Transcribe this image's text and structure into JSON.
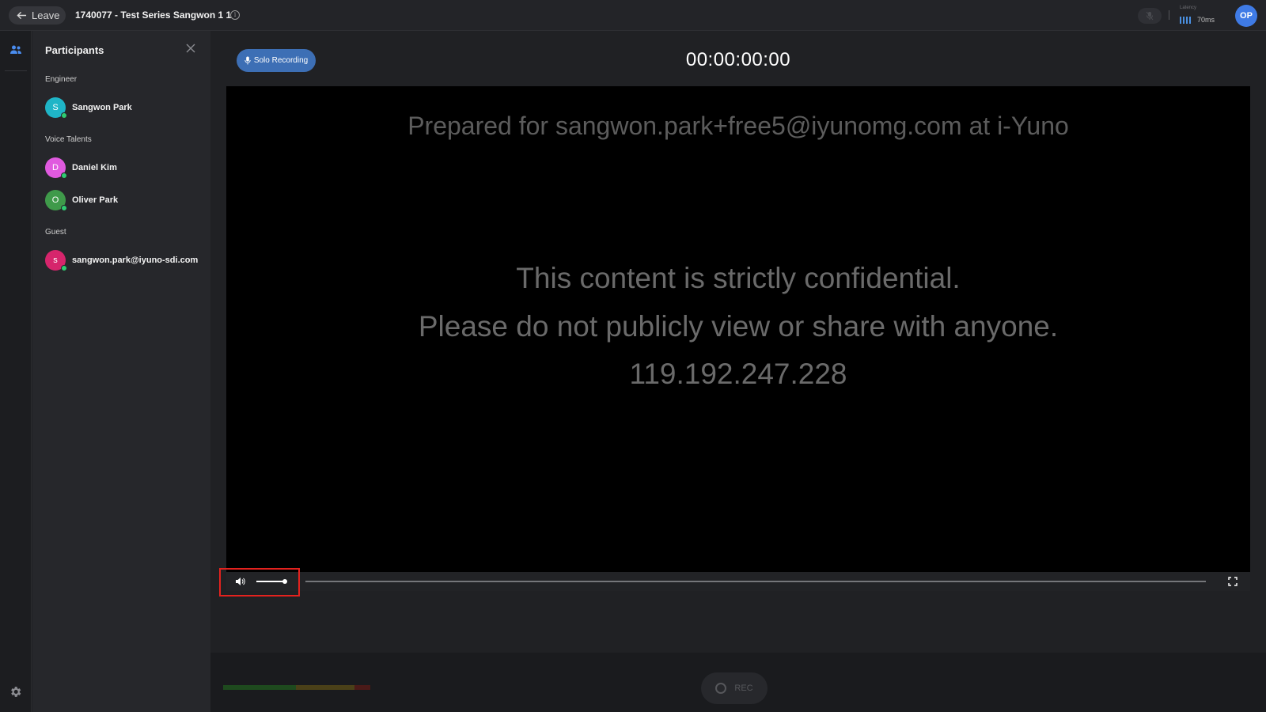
{
  "topbar": {
    "leave_label": "Leave",
    "session_title": "1740077 - Test Series Sangwon 1 1",
    "latency_label": "Latency",
    "latency_value": "70ms",
    "user_initials": "OP"
  },
  "panel": {
    "title": "Participants",
    "groups": [
      {
        "label": "Engineer",
        "members": [
          {
            "initial": "S",
            "name": "Sangwon Park",
            "color": "#1fb5c7"
          }
        ]
      },
      {
        "label": "Voice Talents",
        "members": [
          {
            "initial": "D",
            "name": "Daniel Kim",
            "color": "#e05adf"
          },
          {
            "initial": "O",
            "name": "Oliver Park",
            "color": "#3f9a4a"
          }
        ]
      },
      {
        "label": "Guest",
        "members": [
          {
            "initial": "s",
            "name": "sangwon.park@iyuno-sdi.com",
            "color": "#d6256c"
          }
        ]
      }
    ]
  },
  "main": {
    "solo_label": "Solo Recording",
    "timer": "00:00:00:00",
    "watermark_prepared": "Prepared for sangwon.park+free5@iyunomg.com at i-Yuno",
    "watermark_line1": "This content is strictly confidential.",
    "watermark_line2": "Please do not publicly view or share with anyone.",
    "watermark_ip": "119.192.247.228",
    "rec_label": "REC"
  },
  "colors": {
    "accent": "#3f7be6",
    "highlight": "#e3221e",
    "online": "#2ecc71"
  },
  "icons": [
    "back-arrow-icon",
    "info-icon",
    "mic-muted-icon",
    "people-icon",
    "close-icon",
    "mic-icon",
    "volume-icon",
    "fullscreen-icon",
    "gear-icon"
  ]
}
